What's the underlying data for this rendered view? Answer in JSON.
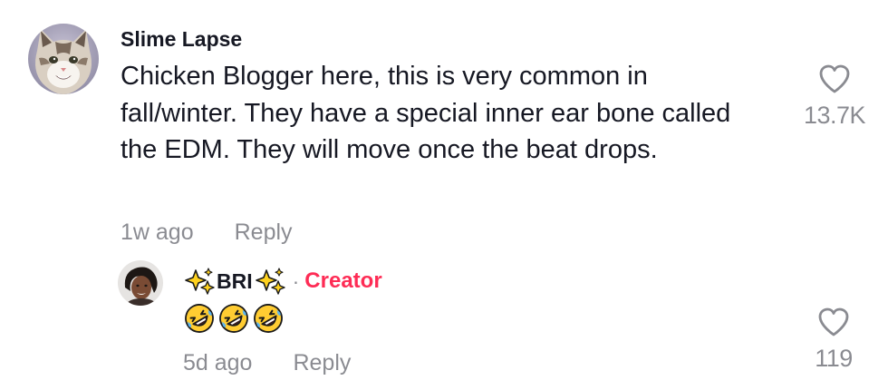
{
  "comment": {
    "username": "Slime Lapse",
    "text": "Chicken Blogger here, this is very common in fall/winter. They have a special inner ear bone called the EDM. They will move once the beat drops.",
    "timestamp": "1w ago",
    "reply_label": "Reply",
    "like_count": "13.7K",
    "avatar_icon": "cat-avatar",
    "like_icon": "heart-outline-icon"
  },
  "reply": {
    "username": "BRI",
    "username_decoration_icon": "sparkles-icon",
    "separator": "·",
    "badge": "Creator",
    "badge_color": "#fe2c55",
    "content_icons": [
      "rolling-on-floor-laughing-emoji",
      "rolling-on-floor-laughing-emoji",
      "rolling-on-floor-laughing-emoji"
    ],
    "timestamp": "5d ago",
    "reply_label": "Reply",
    "like_count": "119",
    "avatar_icon": "person-avatar",
    "like_icon": "heart-outline-icon"
  }
}
